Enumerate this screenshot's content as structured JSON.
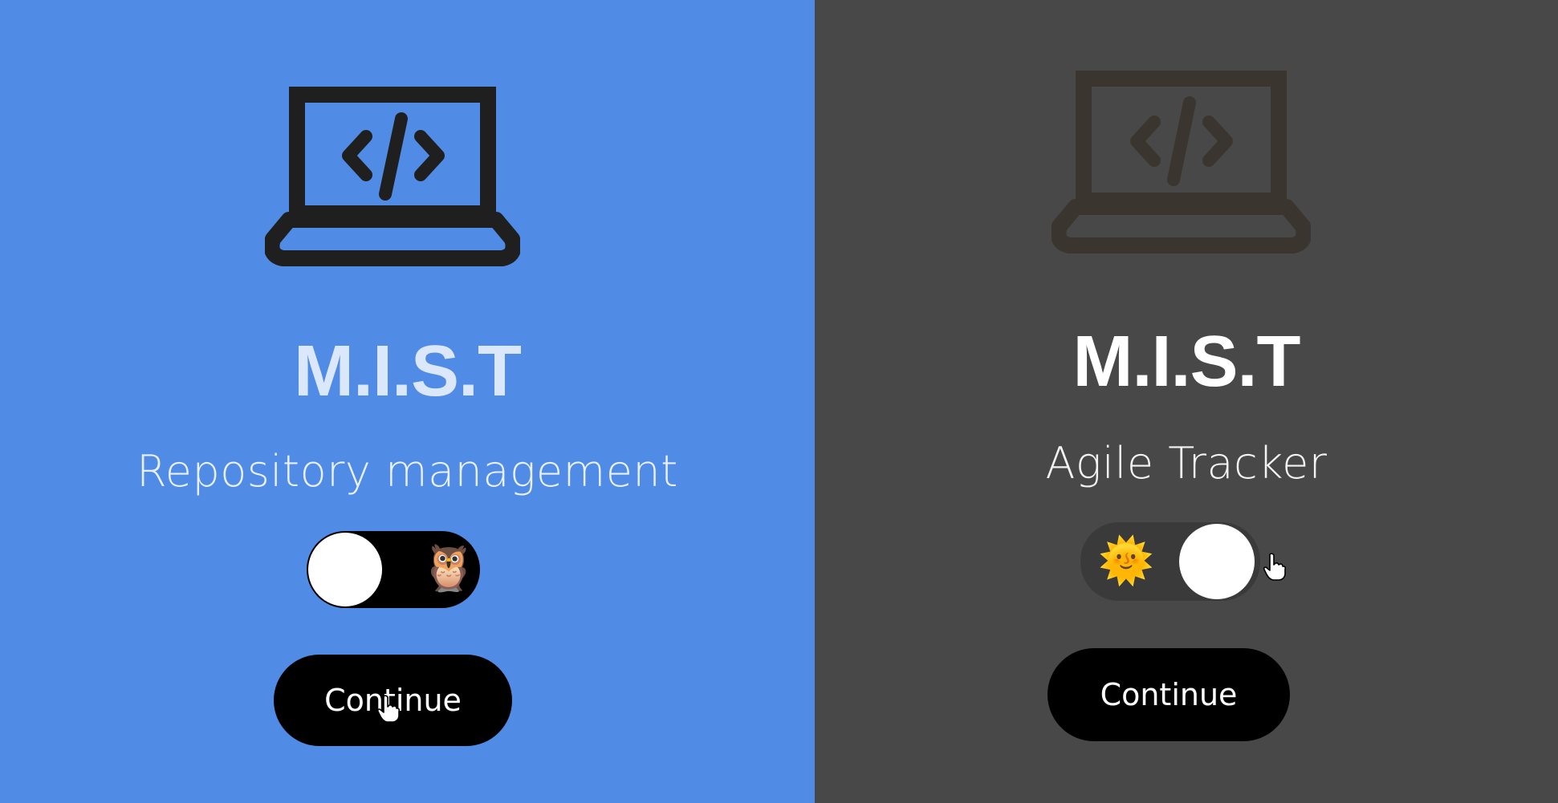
{
  "left_panel": {
    "brand": "M.I.S.T",
    "subtitle": "Repository management",
    "toggle_emoji": "🦉",
    "continue_label": "Continue",
    "background": "#508be5",
    "icon": "laptop-code-icon"
  },
  "right_panel": {
    "brand": "M.I.S.T",
    "subtitle": "Agile Tracker",
    "toggle_emoji": "🌞",
    "continue_label": "Continue",
    "background": "#484848",
    "icon": "laptop-code-icon"
  }
}
